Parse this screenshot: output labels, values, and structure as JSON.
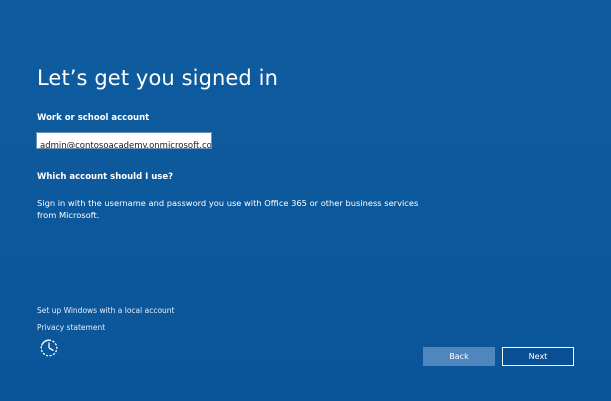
{
  "page": {
    "title": "Let’s get you signed in"
  },
  "form": {
    "account_label": "Work or school account",
    "account_value": "admin@contosoacademy.onmicrosoft.com"
  },
  "help": {
    "question": "Which account should I use?",
    "description": "Sign in with the username and password you use with Office 365 or other business services from Microsoft."
  },
  "links": {
    "local_account": "Set up Windows with a local account",
    "privacy": "Privacy statement"
  },
  "buttons": {
    "back": "Back",
    "next": "Next"
  },
  "icons": {
    "accessibility": "ease-of-access-icon"
  },
  "colors": {
    "background": "#0d5a9e",
    "back_button": "#4f86bd",
    "next_button": "#0a4f93"
  }
}
